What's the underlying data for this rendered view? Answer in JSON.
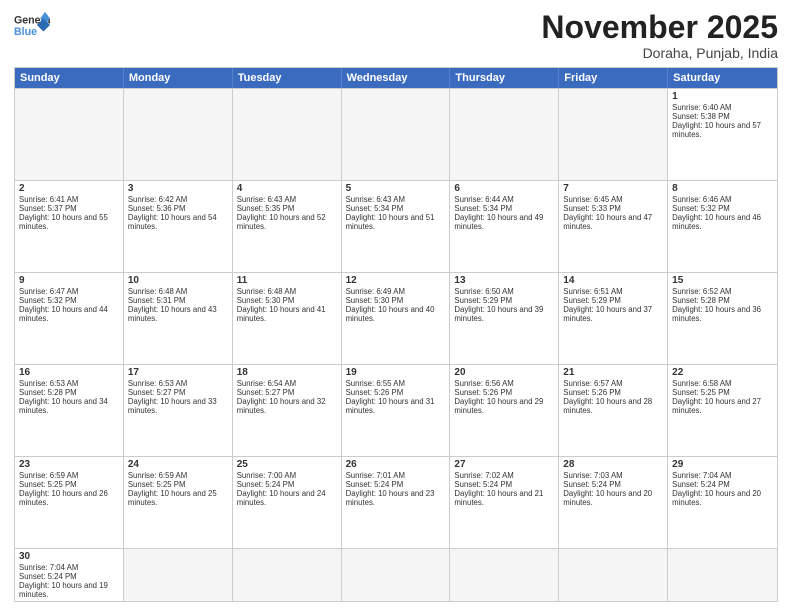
{
  "header": {
    "logo_general": "General",
    "logo_blue": "Blue",
    "month_title": "November 2025",
    "location": "Doraha, Punjab, India"
  },
  "days_of_week": [
    "Sunday",
    "Monday",
    "Tuesday",
    "Wednesday",
    "Thursday",
    "Friday",
    "Saturday"
  ],
  "weeks": [
    [
      {
        "day": null,
        "empty": true
      },
      {
        "day": null,
        "empty": true
      },
      {
        "day": null,
        "empty": true
      },
      {
        "day": null,
        "empty": true
      },
      {
        "day": null,
        "empty": true
      },
      {
        "day": null,
        "empty": true
      },
      {
        "day": 1,
        "sunrise": "6:40 AM",
        "sunset": "5:38 PM",
        "daylight": "10 hours and 57 minutes."
      }
    ],
    [
      {
        "day": 2,
        "sunrise": "6:41 AM",
        "sunset": "5:37 PM",
        "daylight": "10 hours and 55 minutes."
      },
      {
        "day": 3,
        "sunrise": "6:42 AM",
        "sunset": "5:36 PM",
        "daylight": "10 hours and 54 minutes."
      },
      {
        "day": 4,
        "sunrise": "6:43 AM",
        "sunset": "5:35 PM",
        "daylight": "10 hours and 52 minutes."
      },
      {
        "day": 5,
        "sunrise": "6:43 AM",
        "sunset": "5:34 PM",
        "daylight": "10 hours and 51 minutes."
      },
      {
        "day": 6,
        "sunrise": "6:44 AM",
        "sunset": "5:34 PM",
        "daylight": "10 hours and 49 minutes."
      },
      {
        "day": 7,
        "sunrise": "6:45 AM",
        "sunset": "5:33 PM",
        "daylight": "10 hours and 47 minutes."
      },
      {
        "day": 8,
        "sunrise": "6:46 AM",
        "sunset": "5:32 PM",
        "daylight": "10 hours and 46 minutes."
      }
    ],
    [
      {
        "day": 9,
        "sunrise": "6:47 AM",
        "sunset": "5:32 PM",
        "daylight": "10 hours and 44 minutes."
      },
      {
        "day": 10,
        "sunrise": "6:48 AM",
        "sunset": "5:31 PM",
        "daylight": "10 hours and 43 minutes."
      },
      {
        "day": 11,
        "sunrise": "6:48 AM",
        "sunset": "5:30 PM",
        "daylight": "10 hours and 41 minutes."
      },
      {
        "day": 12,
        "sunrise": "6:49 AM",
        "sunset": "5:30 PM",
        "daylight": "10 hours and 40 minutes."
      },
      {
        "day": 13,
        "sunrise": "6:50 AM",
        "sunset": "5:29 PM",
        "daylight": "10 hours and 39 minutes."
      },
      {
        "day": 14,
        "sunrise": "6:51 AM",
        "sunset": "5:29 PM",
        "daylight": "10 hours and 37 minutes."
      },
      {
        "day": 15,
        "sunrise": "6:52 AM",
        "sunset": "5:28 PM",
        "daylight": "10 hours and 36 minutes."
      }
    ],
    [
      {
        "day": 16,
        "sunrise": "6:53 AM",
        "sunset": "5:28 PM",
        "daylight": "10 hours and 34 minutes."
      },
      {
        "day": 17,
        "sunrise": "6:53 AM",
        "sunset": "5:27 PM",
        "daylight": "10 hours and 33 minutes."
      },
      {
        "day": 18,
        "sunrise": "6:54 AM",
        "sunset": "5:27 PM",
        "daylight": "10 hours and 32 minutes."
      },
      {
        "day": 19,
        "sunrise": "6:55 AM",
        "sunset": "5:26 PM",
        "daylight": "10 hours and 31 minutes."
      },
      {
        "day": 20,
        "sunrise": "6:56 AM",
        "sunset": "5:26 PM",
        "daylight": "10 hours and 29 minutes."
      },
      {
        "day": 21,
        "sunrise": "6:57 AM",
        "sunset": "5:26 PM",
        "daylight": "10 hours and 28 minutes."
      },
      {
        "day": 22,
        "sunrise": "6:58 AM",
        "sunset": "5:25 PM",
        "daylight": "10 hours and 27 minutes."
      }
    ],
    [
      {
        "day": 23,
        "sunrise": "6:59 AM",
        "sunset": "5:25 PM",
        "daylight": "10 hours and 26 minutes."
      },
      {
        "day": 24,
        "sunrise": "6:59 AM",
        "sunset": "5:25 PM",
        "daylight": "10 hours and 25 minutes."
      },
      {
        "day": 25,
        "sunrise": "7:00 AM",
        "sunset": "5:24 PM",
        "daylight": "10 hours and 24 minutes."
      },
      {
        "day": 26,
        "sunrise": "7:01 AM",
        "sunset": "5:24 PM",
        "daylight": "10 hours and 23 minutes."
      },
      {
        "day": 27,
        "sunrise": "7:02 AM",
        "sunset": "5:24 PM",
        "daylight": "10 hours and 21 minutes."
      },
      {
        "day": 28,
        "sunrise": "7:03 AM",
        "sunset": "5:24 PM",
        "daylight": "10 hours and 20 minutes."
      },
      {
        "day": 29,
        "sunrise": "7:04 AM",
        "sunset": "5:24 PM",
        "daylight": "10 hours and 20 minutes."
      }
    ],
    [
      {
        "day": 30,
        "sunrise": "7:04 AM",
        "sunset": "5:24 PM",
        "daylight": "10 hours and 19 minutes."
      },
      {
        "day": null,
        "empty": true
      },
      {
        "day": null,
        "empty": true
      },
      {
        "day": null,
        "empty": true
      },
      {
        "day": null,
        "empty": true
      },
      {
        "day": null,
        "empty": true
      },
      {
        "day": null,
        "empty": true
      }
    ]
  ]
}
